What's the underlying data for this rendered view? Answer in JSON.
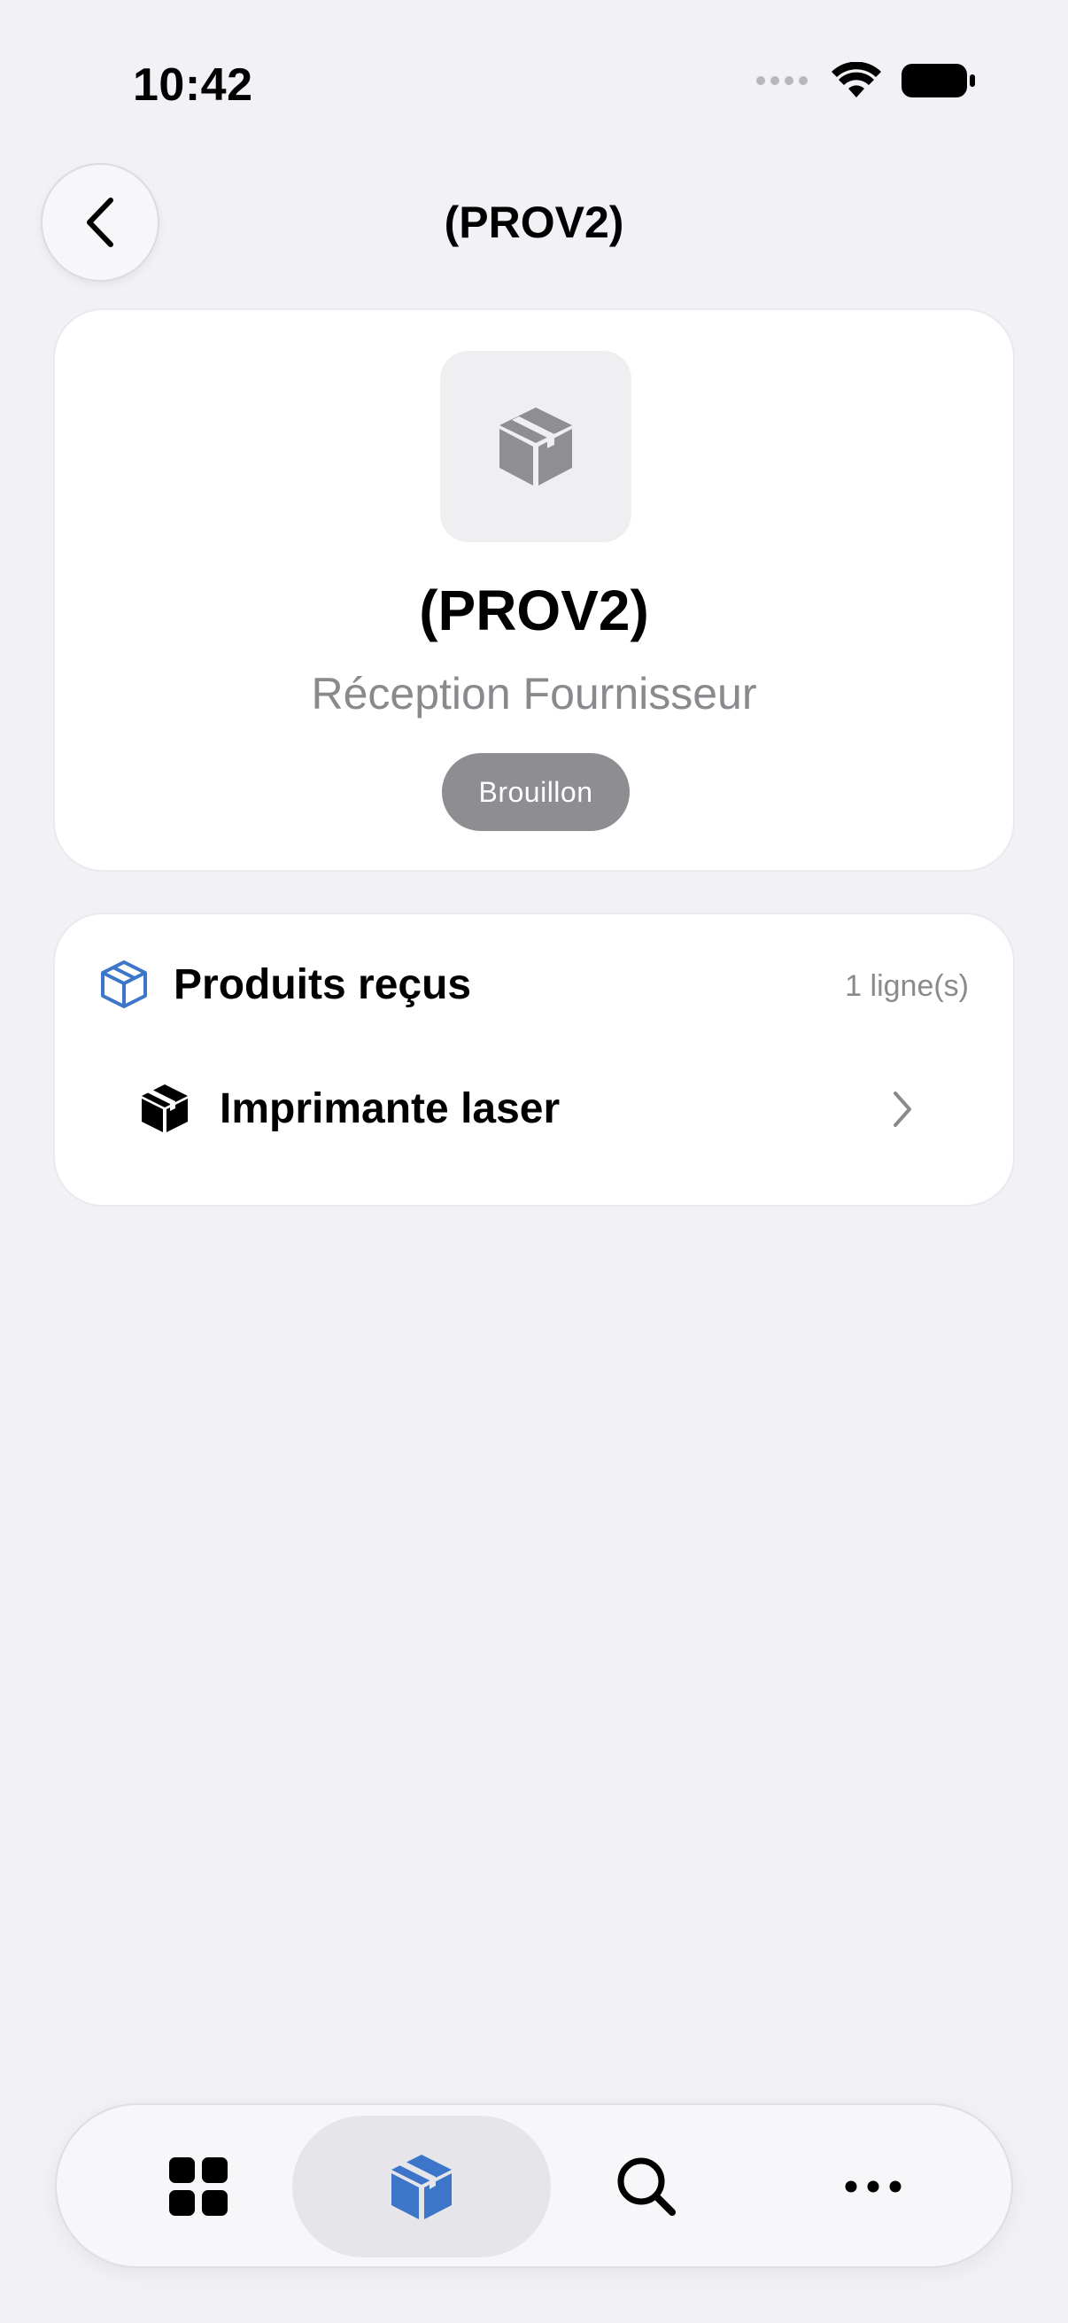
{
  "status_bar": {
    "time": "10:42"
  },
  "nav": {
    "title": "(PROV2)"
  },
  "header": {
    "title": "(PROV2)",
    "subtitle": "Réception Fournisseur",
    "status": "Brouillon"
  },
  "products_section": {
    "title": "Produits reçus",
    "count": "1 ligne(s)",
    "items": [
      {
        "label": "Imprimante laser"
      }
    ]
  },
  "tab_bar": {
    "active_tab": "products",
    "accent_color": "#3d76c9"
  }
}
